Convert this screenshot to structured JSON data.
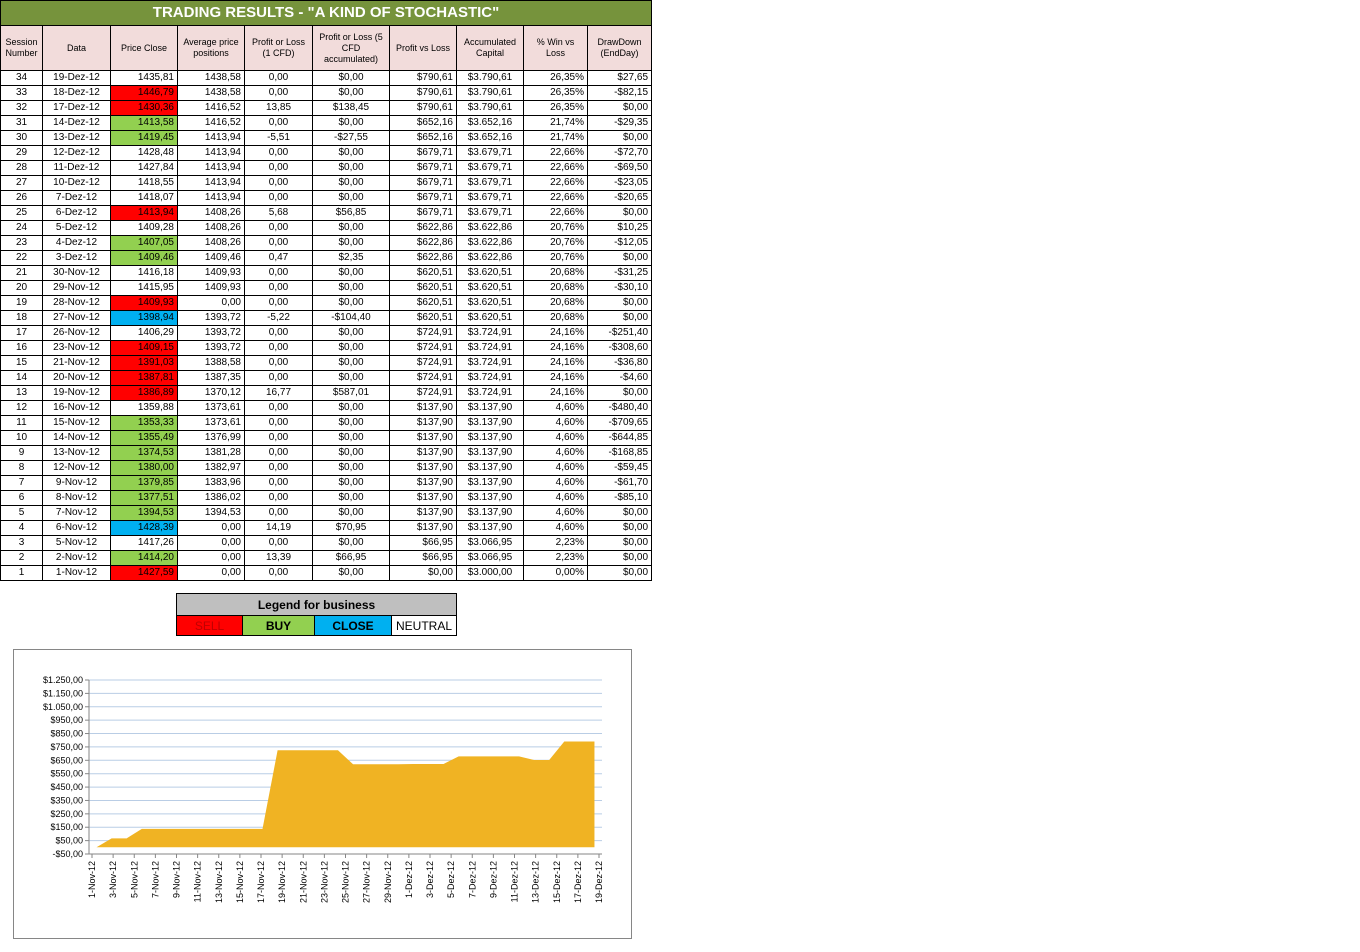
{
  "sheet_title": "TRADING RESULTS - \"A KIND OF STOCHASTIC\"",
  "headers": [
    "Session Number",
    "Data",
    "Price Close",
    "Average price positions",
    "Profit or Loss (1 CFD)",
    "Profit or Loss (5 CFD accumulated)",
    "Profit vs Loss",
    "Accumulated Capital",
    "% Win vs Loss",
    "DrawDown (EndDay)"
  ],
  "rows": [
    {
      "session": "34",
      "date": "19-Dez-12",
      "price": "1435,81",
      "signal": "neutral",
      "avg": "1438,58",
      "pl1": "0,00",
      "pl5": "$0,00",
      "pvl": "$790,61",
      "capital": "$3.790,61",
      "win": "26,35%",
      "dd": "$27,65"
    },
    {
      "session": "33",
      "date": "18-Dez-12",
      "price": "1446,79",
      "signal": "sell",
      "avg": "1438,58",
      "pl1": "0,00",
      "pl5": "$0,00",
      "pvl": "$790,61",
      "capital": "$3.790,61",
      "win": "26,35%",
      "dd": "-$82,15"
    },
    {
      "session": "32",
      "date": "17-Dez-12",
      "price": "1430,36",
      "signal": "sell",
      "avg": "1416,52",
      "pl1": "13,85",
      "pl5": "$138,45",
      "pvl": "$790,61",
      "capital": "$3.790,61",
      "win": "26,35%",
      "dd": "$0,00"
    },
    {
      "session": "31",
      "date": "14-Dez-12",
      "price": "1413,58",
      "signal": "buy",
      "avg": "1416,52",
      "pl1": "0,00",
      "pl5": "$0,00",
      "pvl": "$652,16",
      "capital": "$3.652,16",
      "win": "21,74%",
      "dd": "-$29,35"
    },
    {
      "session": "30",
      "date": "13-Dez-12",
      "price": "1419,45",
      "signal": "buy",
      "avg": "1413,94",
      "pl1": "-5,51",
      "pl5": "-$27,55",
      "pvl": "$652,16",
      "capital": "$3.652,16",
      "win": "21,74%",
      "dd": "$0,00"
    },
    {
      "session": "29",
      "date": "12-Dez-12",
      "price": "1428,48",
      "signal": "neutral",
      "avg": "1413,94",
      "pl1": "0,00",
      "pl5": "$0,00",
      "pvl": "$679,71",
      "capital": "$3.679,71",
      "win": "22,66%",
      "dd": "-$72,70"
    },
    {
      "session": "28",
      "date": "11-Dez-12",
      "price": "1427,84",
      "signal": "neutral",
      "avg": "1413,94",
      "pl1": "0,00",
      "pl5": "$0,00",
      "pvl": "$679,71",
      "capital": "$3.679,71",
      "win": "22,66%",
      "dd": "-$69,50"
    },
    {
      "session": "27",
      "date": "10-Dez-12",
      "price": "1418,55",
      "signal": "neutral",
      "avg": "1413,94",
      "pl1": "0,00",
      "pl5": "$0,00",
      "pvl": "$679,71",
      "capital": "$3.679,71",
      "win": "22,66%",
      "dd": "-$23,05"
    },
    {
      "session": "26",
      "date": "7-Dez-12",
      "price": "1418,07",
      "signal": "neutral",
      "avg": "1413,94",
      "pl1": "0,00",
      "pl5": "$0,00",
      "pvl": "$679,71",
      "capital": "$3.679,71",
      "win": "22,66%",
      "dd": "-$20,65"
    },
    {
      "session": "25",
      "date": "6-Dez-12",
      "price": "1413,94",
      "signal": "sell",
      "avg": "1408,26",
      "pl1": "5,68",
      "pl5": "$56,85",
      "pvl": "$679,71",
      "capital": "$3.679,71",
      "win": "22,66%",
      "dd": "$0,00"
    },
    {
      "session": "24",
      "date": "5-Dez-12",
      "price": "1409,28",
      "signal": "neutral",
      "avg": "1408,26",
      "pl1": "0,00",
      "pl5": "$0,00",
      "pvl": "$622,86",
      "capital": "$3.622,86",
      "win": "20,76%",
      "dd": "$10,25"
    },
    {
      "session": "23",
      "date": "4-Dez-12",
      "price": "1407,05",
      "signal": "buy",
      "avg": "1408,26",
      "pl1": "0,00",
      "pl5": "$0,00",
      "pvl": "$622,86",
      "capital": "$3.622,86",
      "win": "20,76%",
      "dd": "-$12,05"
    },
    {
      "session": "22",
      "date": "3-Dez-12",
      "price": "1409,46",
      "signal": "buy",
      "avg": "1409,46",
      "pl1": "0,47",
      "pl5": "$2,35",
      "pvl": "$622,86",
      "capital": "$3.622,86",
      "win": "20,76%",
      "dd": "$0,00"
    },
    {
      "session": "21",
      "date": "30-Nov-12",
      "price": "1416,18",
      "signal": "neutral",
      "avg": "1409,93",
      "pl1": "0,00",
      "pl5": "$0,00",
      "pvl": "$620,51",
      "capital": "$3.620,51",
      "win": "20,68%",
      "dd": "-$31,25"
    },
    {
      "session": "20",
      "date": "29-Nov-12",
      "price": "1415,95",
      "signal": "neutral",
      "avg": "1409,93",
      "pl1": "0,00",
      "pl5": "$0,00",
      "pvl": "$620,51",
      "capital": "$3.620,51",
      "win": "20,68%",
      "dd": "-$30,10"
    },
    {
      "session": "19",
      "date": "28-Nov-12",
      "price": "1409,93",
      "signal": "sell",
      "avg": "0,00",
      "pl1": "0,00",
      "pl5": "$0,00",
      "pvl": "$620,51",
      "capital": "$3.620,51",
      "win": "20,68%",
      "dd": "$0,00"
    },
    {
      "session": "18",
      "date": "27-Nov-12",
      "price": "1398,94",
      "signal": "close",
      "avg": "1393,72",
      "pl1": "-5,22",
      "pl5": "-$104,40",
      "pvl": "$620,51",
      "capital": "$3.620,51",
      "win": "20,68%",
      "dd": "$0,00"
    },
    {
      "session": "17",
      "date": "26-Nov-12",
      "price": "1406,29",
      "signal": "neutral",
      "avg": "1393,72",
      "pl1": "0,00",
      "pl5": "$0,00",
      "pvl": "$724,91",
      "capital": "$3.724,91",
      "win": "24,16%",
      "dd": "-$251,40"
    },
    {
      "session": "16",
      "date": "23-Nov-12",
      "price": "1409,15",
      "signal": "sell",
      "avg": "1393,72",
      "pl1": "0,00",
      "pl5": "$0,00",
      "pvl": "$724,91",
      "capital": "$3.724,91",
      "win": "24,16%",
      "dd": "-$308,60"
    },
    {
      "session": "15",
      "date": "21-Nov-12",
      "price": "1391,03",
      "signal": "sell",
      "avg": "1388,58",
      "pl1": "0,00",
      "pl5": "$0,00",
      "pvl": "$724,91",
      "capital": "$3.724,91",
      "win": "24,16%",
      "dd": "-$36,80"
    },
    {
      "session": "14",
      "date": "20-Nov-12",
      "price": "1387,81",
      "signal": "sell",
      "avg": "1387,35",
      "pl1": "0,00",
      "pl5": "$0,00",
      "pvl": "$724,91",
      "capital": "$3.724,91",
      "win": "24,16%",
      "dd": "-$4,60"
    },
    {
      "session": "13",
      "date": "19-Nov-12",
      "price": "1386,89",
      "signal": "sell",
      "avg": "1370,12",
      "pl1": "16,77",
      "pl5": "$587,01",
      "pvl": "$724,91",
      "capital": "$3.724,91",
      "win": "24,16%",
      "dd": "$0,00"
    },
    {
      "session": "12",
      "date": "16-Nov-12",
      "price": "1359,88",
      "signal": "neutral",
      "avg": "1373,61",
      "pl1": "0,00",
      "pl5": "$0,00",
      "pvl": "$137,90",
      "capital": "$3.137,90",
      "win": "4,60%",
      "dd": "-$480,40"
    },
    {
      "session": "11",
      "date": "15-Nov-12",
      "price": "1353,33",
      "signal": "buy",
      "avg": "1373,61",
      "pl1": "0,00",
      "pl5": "$0,00",
      "pvl": "$137,90",
      "capital": "$3.137,90",
      "win": "4,60%",
      "dd": "-$709,65"
    },
    {
      "session": "10",
      "date": "14-Nov-12",
      "price": "1355,49",
      "signal": "buy",
      "avg": "1376,99",
      "pl1": "0,00",
      "pl5": "$0,00",
      "pvl": "$137,90",
      "capital": "$3.137,90",
      "win": "4,60%",
      "dd": "-$644,85"
    },
    {
      "session": "9",
      "date": "13-Nov-12",
      "price": "1374,53",
      "signal": "buy",
      "avg": "1381,28",
      "pl1": "0,00",
      "pl5": "$0,00",
      "pvl": "$137,90",
      "capital": "$3.137,90",
      "win": "4,60%",
      "dd": "-$168,85"
    },
    {
      "session": "8",
      "date": "12-Nov-12",
      "price": "1380,00",
      "signal": "buy",
      "avg": "1382,97",
      "pl1": "0,00",
      "pl5": "$0,00",
      "pvl": "$137,90",
      "capital": "$3.137,90",
      "win": "4,60%",
      "dd": "-$59,45"
    },
    {
      "session": "7",
      "date": "9-Nov-12",
      "price": "1379,85",
      "signal": "buy",
      "avg": "1383,96",
      "pl1": "0,00",
      "pl5": "$0,00",
      "pvl": "$137,90",
      "capital": "$3.137,90",
      "win": "4,60%",
      "dd": "-$61,70"
    },
    {
      "session": "6",
      "date": "8-Nov-12",
      "price": "1377,51",
      "signal": "buy",
      "avg": "1386,02",
      "pl1": "0,00",
      "pl5": "$0,00",
      "pvl": "$137,90",
      "capital": "$3.137,90",
      "win": "4,60%",
      "dd": "-$85,10"
    },
    {
      "session": "5",
      "date": "7-Nov-12",
      "price": "1394,53",
      "signal": "buy",
      "avg": "1394,53",
      "pl1": "0,00",
      "pl5": "$0,00",
      "pvl": "$137,90",
      "capital": "$3.137,90",
      "win": "4,60%",
      "dd": "$0,00"
    },
    {
      "session": "4",
      "date": "6-Nov-12",
      "price": "1428,39",
      "signal": "close",
      "avg": "0,00",
      "pl1": "14,19",
      "pl5": "$70,95",
      "pvl": "$137,90",
      "capital": "$3.137,90",
      "win": "4,60%",
      "dd": "$0,00"
    },
    {
      "session": "3",
      "date": "5-Nov-12",
      "price": "1417,26",
      "signal": "neutral",
      "avg": "0,00",
      "pl1": "0,00",
      "pl5": "$0,00",
      "pvl": "$66,95",
      "capital": "$3.066,95",
      "win": "2,23%",
      "dd": "$0,00"
    },
    {
      "session": "2",
      "date": "2-Nov-12",
      "price": "1414,20",
      "signal": "buy",
      "avg": "0,00",
      "pl1": "13,39",
      "pl5": "$66,95",
      "pvl": "$66,95",
      "capital": "$3.066,95",
      "win": "2,23%",
      "dd": "$0,00"
    },
    {
      "session": "1",
      "date": "1-Nov-12",
      "price": "1427,59",
      "signal": "sell",
      "avg": "0,00",
      "pl1": "0,00",
      "pl5": "$0,00",
      "pvl": "$0,00",
      "capital": "$3.000,00",
      "win": "0,00%",
      "dd": "$0,00"
    }
  ],
  "legend": {
    "title": "Legend for business",
    "sell": "SELL",
    "buy": "BUY",
    "close": "CLOSE",
    "neutral": "NEUTRAL"
  },
  "colors": {
    "title_bg": "#76933c",
    "header_bg": "#f2dcdb",
    "sell": "#ff0000",
    "buy": "#92d050",
    "close": "#00b0f0",
    "area_fill": "#f0b323",
    "gridline": "#b9cde5"
  },
  "chart_data": {
    "type": "area",
    "title": "",
    "xlabel": "",
    "ylabel": "",
    "ylim": [
      -50,
      1250
    ],
    "ytick_step": 100,
    "yticks": [
      "$1.250,00",
      "$1.150,00",
      "$1.050,00",
      "$950,00",
      "$850,00",
      "$750,00",
      "$650,00",
      "$550,00",
      "$450,00",
      "$350,00",
      "$250,00",
      "$150,00",
      "$50,00",
      "-$50,00"
    ],
    "grid": true,
    "legend": "none",
    "x": [
      "1-Nov-12",
      "2-Nov-12",
      "5-Nov-12",
      "6-Nov-12",
      "7-Nov-12",
      "8-Nov-12",
      "9-Nov-12",
      "12-Nov-12",
      "13-Nov-12",
      "14-Nov-12",
      "15-Nov-12",
      "16-Nov-12",
      "19-Nov-12",
      "20-Nov-12",
      "21-Nov-12",
      "23-Nov-12",
      "26-Nov-12",
      "27-Nov-12",
      "28-Nov-12",
      "29-Nov-12",
      "30-Nov-12",
      "3-Dez-12",
      "4-Dez-12",
      "5-Dez-12",
      "6-Dez-12",
      "7-Dez-12",
      "10-Dez-12",
      "11-Dez-12",
      "12-Dez-12",
      "13-Dez-12",
      "14-Dez-12",
      "17-Dez-12",
      "18-Dez-12",
      "19-Dez-12"
    ],
    "xtick_labels": [
      "1-Nov-12",
      "3-Nov-12",
      "5-Nov-12",
      "7-Nov-12",
      "9-Nov-12",
      "11-Nov-12",
      "13-Nov-12",
      "15-Nov-12",
      "17-Nov-12",
      "19-Nov-12",
      "21-Nov-12",
      "23-Nov-12",
      "25-Nov-12",
      "27-Nov-12",
      "29-Nov-12",
      "1-Dez-12",
      "3-Dez-12",
      "5-Dez-12",
      "7-Dez-12",
      "9-Dez-12",
      "11-Dez-12",
      "13-Dez-12",
      "15-Dez-12",
      "17-Dez-12",
      "19-Dez-12"
    ],
    "series": [
      {
        "values": [
          0,
          66.95,
          66.95,
          137.9,
          137.9,
          137.9,
          137.9,
          137.9,
          137.9,
          137.9,
          137.9,
          137.9,
          724.91,
          724.91,
          724.91,
          724.91,
          724.91,
          620.51,
          620.51,
          620.51,
          620.51,
          622.86,
          622.86,
          622.86,
          679.71,
          679.71,
          679.71,
          679.71,
          679.71,
          652.16,
          652.16,
          790.61,
          790.61,
          790.61
        ]
      }
    ]
  }
}
